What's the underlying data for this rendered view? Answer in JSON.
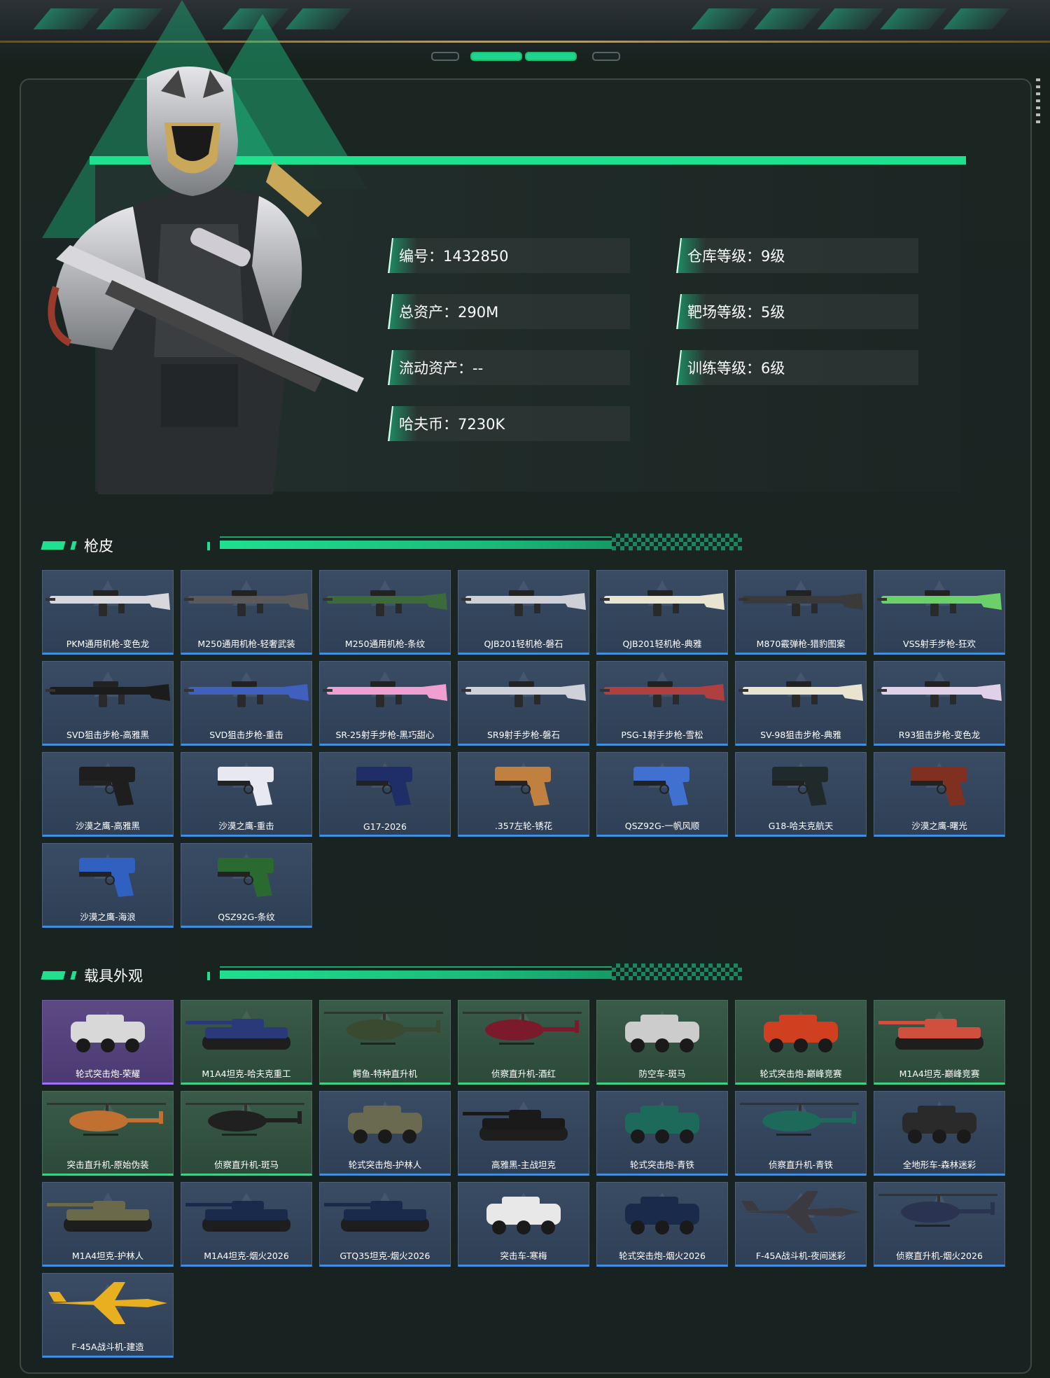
{
  "profile": {
    "id_line": "编号：1432850",
    "total_assets": "总资产：290M",
    "liquid_assets": "流动资产：--",
    "havoc_coins": "哈夫币：7230K",
    "warehouse_level": "仓库等级：9级",
    "range_level": "靶场等级：5级",
    "training_level": "训练等级：6级"
  },
  "sections": {
    "gun_skins_title": "枪皮",
    "vehicle_skins_title": "载具外观"
  },
  "gun_skins": [
    {
      "name": "PKM通用机枪-变色龙",
      "kind": "rifle",
      "color": "#d8d8dc"
    },
    {
      "name": "M250通用机枪-轻奢武装",
      "kind": "rifle",
      "color": "#5a5a5a"
    },
    {
      "name": "M250通用机枪-条纹",
      "kind": "rifle",
      "color": "#3c6a3a"
    },
    {
      "name": "QJB201轻机枪-磐石",
      "kind": "rifle",
      "color": "#cfcfd6"
    },
    {
      "name": "QJB201轻机枪-典雅",
      "kind": "rifle",
      "color": "#e8e4d0"
    },
    {
      "name": "M870霰弹枪-猎豹图案",
      "kind": "rifle",
      "color": "#3a3a3a"
    },
    {
      "name": "VSS射手步枪-狂欢",
      "kind": "rifle",
      "color": "#6bd06a"
    },
    {
      "name": "SVD狙击步枪-高雅黑",
      "kind": "rifle",
      "color": "#1c1c1c"
    },
    {
      "name": "SVD狙击步枪-重击",
      "kind": "rifle",
      "color": "#4060c0"
    },
    {
      "name": "SR-25射手步枪-黑巧甜心",
      "kind": "rifle",
      "color": "#f0a0d0"
    },
    {
      "name": "SR9射手步枪-磐石",
      "kind": "rifle",
      "color": "#d0d0d8"
    },
    {
      "name": "PSG-1射手步枪-雪松",
      "kind": "rifle",
      "color": "#b04040"
    },
    {
      "name": "SV-98狙击步枪-典雅",
      "kind": "rifle",
      "color": "#e8e4d0"
    },
    {
      "name": "R93狙击步枪-变色龙",
      "kind": "rifle",
      "color": "#e0d0e8"
    },
    {
      "name": "沙漠之鹰-高雅黑",
      "kind": "pistol",
      "color": "#1e1e1e"
    },
    {
      "name": "沙漠之鹰-重击",
      "kind": "pistol",
      "color": "#e8e8f0"
    },
    {
      "name": "G17-2026",
      "kind": "pistol",
      "color": "#1f2e66"
    },
    {
      "name": ".357左轮-锈花",
      "kind": "pistol",
      "color": "#c08040"
    },
    {
      "name": "QSZ92G-一帆风顺",
      "kind": "pistol",
      "color": "#4070d0"
    },
    {
      "name": "G18-哈夫克航天",
      "kind": "pistol",
      "color": "#202a2a"
    },
    {
      "name": "沙漠之鹰-曙光",
      "kind": "pistol",
      "color": "#803020"
    },
    {
      "name": "沙漠之鹰-海浪",
      "kind": "pistol",
      "color": "#3060c0"
    },
    {
      "name": "QSZ92G-条纹",
      "kind": "pistol",
      "color": "#2a6a30"
    }
  ],
  "vehicle_skins": [
    {
      "name": "轮式突击炮-荣耀",
      "kind": "car",
      "color": "#d8d8d8",
      "rarity": "purple"
    },
    {
      "name": "M1A4坦克-哈夫克重工",
      "kind": "tank",
      "color": "#2a3a78",
      "rarity": "green"
    },
    {
      "name": "鳄鱼-特种直升机",
      "kind": "heli",
      "color": "#3a4a30",
      "rarity": "green"
    },
    {
      "name": "侦察直升机-酒红",
      "kind": "heli",
      "color": "#7a1a2a",
      "rarity": "green"
    },
    {
      "name": "防空车-斑马",
      "kind": "car",
      "color": "#cccccc",
      "rarity": "green"
    },
    {
      "name": "轮式突击炮-巅峰竞赛",
      "kind": "car",
      "color": "#d04020",
      "rarity": "green"
    },
    {
      "name": "M1A4坦克-巅峰竞赛",
      "kind": "tank",
      "color": "#d05040",
      "rarity": "green"
    },
    {
      "name": "突击直升机-原始伪装",
      "kind": "heli",
      "color": "#c07030",
      "rarity": "green"
    },
    {
      "name": "侦察直升机-斑马",
      "kind": "heli",
      "color": "#202020",
      "rarity": "green"
    },
    {
      "name": "轮式突击炮-护林人",
      "kind": "car",
      "color": "#6a6a50",
      "rarity": "blue"
    },
    {
      "name": "高雅黑-主战坦克",
      "kind": "tank",
      "color": "#1a1a1a",
      "rarity": "blue"
    },
    {
      "name": "轮式突击炮-青铁",
      "kind": "car",
      "color": "#1e6a5a",
      "rarity": "blue"
    },
    {
      "name": "侦察直升机-青铁",
      "kind": "heli",
      "color": "#1e6a5a",
      "rarity": "blue"
    },
    {
      "name": "全地形车-森林迷彩",
      "kind": "car",
      "color": "#2a2a2a",
      "rarity": "blue"
    },
    {
      "name": "M1A4坦克-护林人",
      "kind": "tank",
      "color": "#6a6a4a",
      "rarity": "blue"
    },
    {
      "name": "M1A4坦克-烟火2026",
      "kind": "tank",
      "color": "#1a2a4a",
      "rarity": "blue"
    },
    {
      "name": "GTQ35坦克-烟火2026",
      "kind": "tank",
      "color": "#1a2a4a",
      "rarity": "blue"
    },
    {
      "name": "突击车-寒梅",
      "kind": "car",
      "color": "#e8e8e8",
      "rarity": "blue"
    },
    {
      "name": "轮式突击炮-烟火2026",
      "kind": "car",
      "color": "#1a2a4a",
      "rarity": "blue"
    },
    {
      "name": "F-45A战斗机-夜间迷彩",
      "kind": "jet",
      "color": "#3a3a40",
      "rarity": "blue"
    },
    {
      "name": "侦察直升机-烟火2026",
      "kind": "heli",
      "color": "#2a3450",
      "rarity": "blue"
    },
    {
      "name": "F-45A战斗机-建造",
      "kind": "jet",
      "color": "#e8b020",
      "rarity": "blue"
    }
  ],
  "colors": {
    "accent": "#1ee08f",
    "card_blue": "#3f8ee0",
    "card_green": "#3fcf87",
    "card_purple": "#a070ff",
    "background": "#17221d"
  }
}
